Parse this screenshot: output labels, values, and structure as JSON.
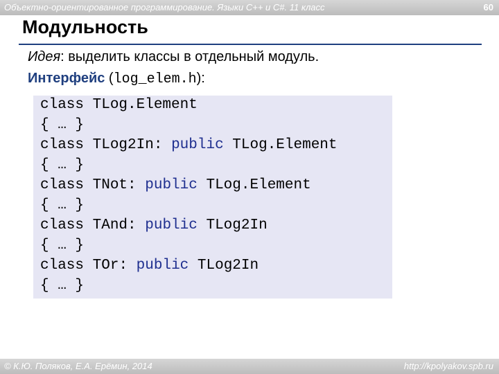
{
  "header": {
    "course_title": "Объектно-ориентированное программирование. Языки C++ и C#. 11 класс",
    "page_number": "60"
  },
  "slide": {
    "title": "Модульность",
    "idea_label": "Идея",
    "idea_text": ": выделить классы в отдельный модуль.",
    "interface_label": "Интерфейс",
    "interface_open": " (",
    "interface_file": "log_elem.h",
    "interface_close": "):"
  },
  "code": {
    "lines": [
      {
        "kw": "class",
        "name": " TLog.Element",
        "sep": "",
        "pub": "",
        "base": ""
      },
      {
        "kw": "{ … }",
        "name": "",
        "sep": "",
        "pub": "",
        "base": ""
      },
      {
        "kw": "class",
        "name": " TLog2In",
        "sep": ": ",
        "pub": "public",
        "base": " TLog.Element"
      },
      {
        "kw": "{ … }",
        "name": "",
        "sep": "",
        "pub": "",
        "base": ""
      },
      {
        "kw": "class",
        "name": " TNot",
        "sep": ": ",
        "pub": "public",
        "base": " TLog.Element"
      },
      {
        "kw": "{ … }",
        "name": "",
        "sep": "",
        "pub": "",
        "base": ""
      },
      {
        "kw": "class",
        "name": " TAnd",
        "sep": ": ",
        "pub": "public",
        "base": " TLog2In"
      },
      {
        "kw": "{ … }",
        "name": "",
        "sep": "",
        "pub": "",
        "base": ""
      },
      {
        "kw": "class",
        "name": " TOr",
        "sep": ": ",
        "pub": "public",
        "base": " TLog2In"
      },
      {
        "kw": "{ … }",
        "name": "",
        "sep": "",
        "pub": "",
        "base": ""
      }
    ]
  },
  "footer": {
    "copyright": "© К.Ю. Поляков, Е.А. Ерёмин, 2014",
    "url": "http://kpolyakov.spb.ru"
  }
}
